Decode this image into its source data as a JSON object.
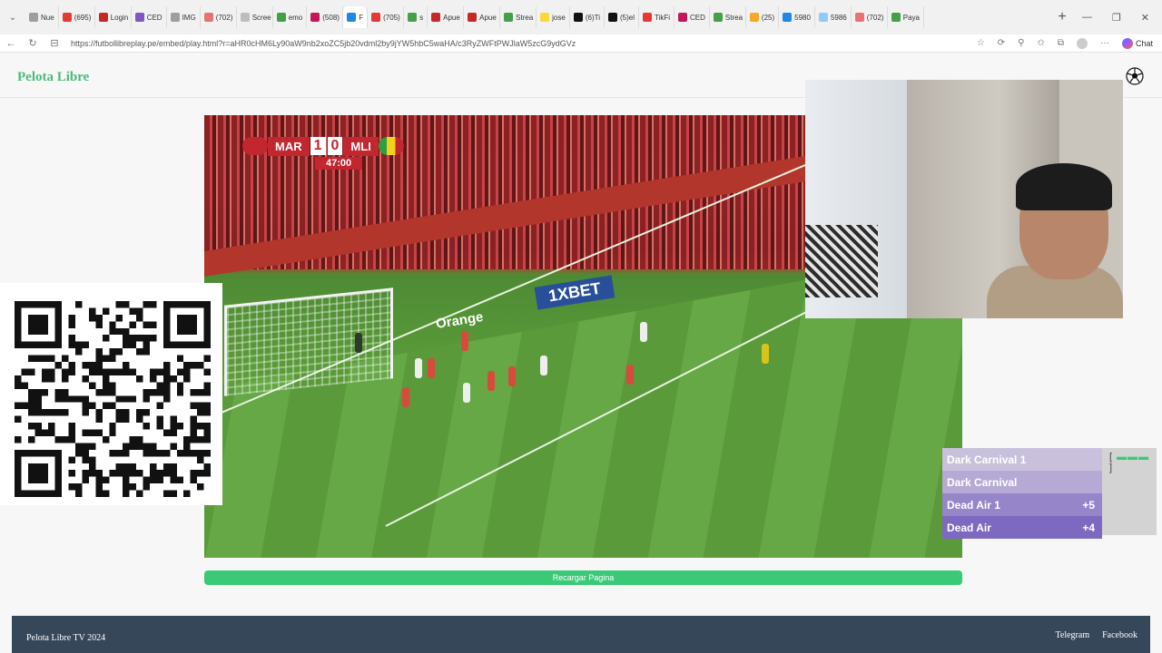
{
  "browser": {
    "tabs": [
      {
        "label": "Nue",
        "color": "#9e9e9e"
      },
      {
        "label": "(695)",
        "color": "#e53935"
      },
      {
        "label": "Login",
        "color": "#c62828"
      },
      {
        "label": "CED",
        "color": "#7e57c2"
      },
      {
        "label": "IMG",
        "color": "#9e9e9e"
      },
      {
        "label": "(702)",
        "color": "#e57373"
      },
      {
        "label": "Scree",
        "color": "#bdbdbd"
      },
      {
        "label": "emo",
        "color": "#43a047"
      },
      {
        "label": "(508)",
        "color": "#c2185b"
      },
      {
        "label": "F",
        "color": "#1e88e5"
      },
      {
        "label": "(705)",
        "color": "#e53935"
      },
      {
        "label": "s",
        "color": "#43a047"
      },
      {
        "label": "Apue",
        "color": "#c62828"
      },
      {
        "label": "Apue",
        "color": "#c62828"
      },
      {
        "label": "Strea",
        "color": "#43a047"
      },
      {
        "label": "jose",
        "color": "#fdd835"
      },
      {
        "label": "(6)Ti",
        "color": "#111111"
      },
      {
        "label": "(5)el",
        "color": "#111111"
      },
      {
        "label": "TikFi",
        "color": "#e53935"
      },
      {
        "label": "CED",
        "color": "#c2185b"
      },
      {
        "label": "Strea",
        "color": "#43a047"
      },
      {
        "label": "(25)",
        "color": "#f9a825"
      },
      {
        "label": "5980",
        "color": "#1e88e5"
      },
      {
        "label": "5986",
        "color": "#90caf9"
      },
      {
        "label": "(702)",
        "color": "#e57373"
      },
      {
        "label": "Paya",
        "color": "#43a047"
      }
    ],
    "active_tab_index": 9,
    "url": "https://futbollibreplay.pe/embed/play.html?r=aHR0cHM6Ly90aW9nb2xoZC5jb20vdml2by9jYW5hbC5waHA/c3RyZWFtPWJlaW5zcG9ydGVz",
    "chat_label": "Chat"
  },
  "site": {
    "logo": "Pelota Libre",
    "reload_label": "Recargar Pagina",
    "footer_copy": "Pelota Libre TV 2024",
    "footer_links": [
      "Telegram",
      "Facebook"
    ]
  },
  "scoreboard": {
    "home": "MAR",
    "home_score": "1",
    "away_score": "0",
    "away": "MLI",
    "time": "47:00"
  },
  "video_ads": {
    "sponsor_1": "1XBET",
    "sponsor_2": "Orange"
  },
  "alerts": [
    {
      "name": "Dark Carnival 1",
      "value": "",
      "bg": "#c9c1dc"
    },
    {
      "name": "Dark Carnival",
      "value": "",
      "bg": "#b6a9d6"
    },
    {
      "name": "Dead Air 1",
      "value": "+5",
      "bg": "#9685c9"
    },
    {
      "name": "Dead Air",
      "value": "+4",
      "bg": "#7d69c0"
    }
  ],
  "bracket_text": {
    "left": "[",
    "right": "]"
  }
}
